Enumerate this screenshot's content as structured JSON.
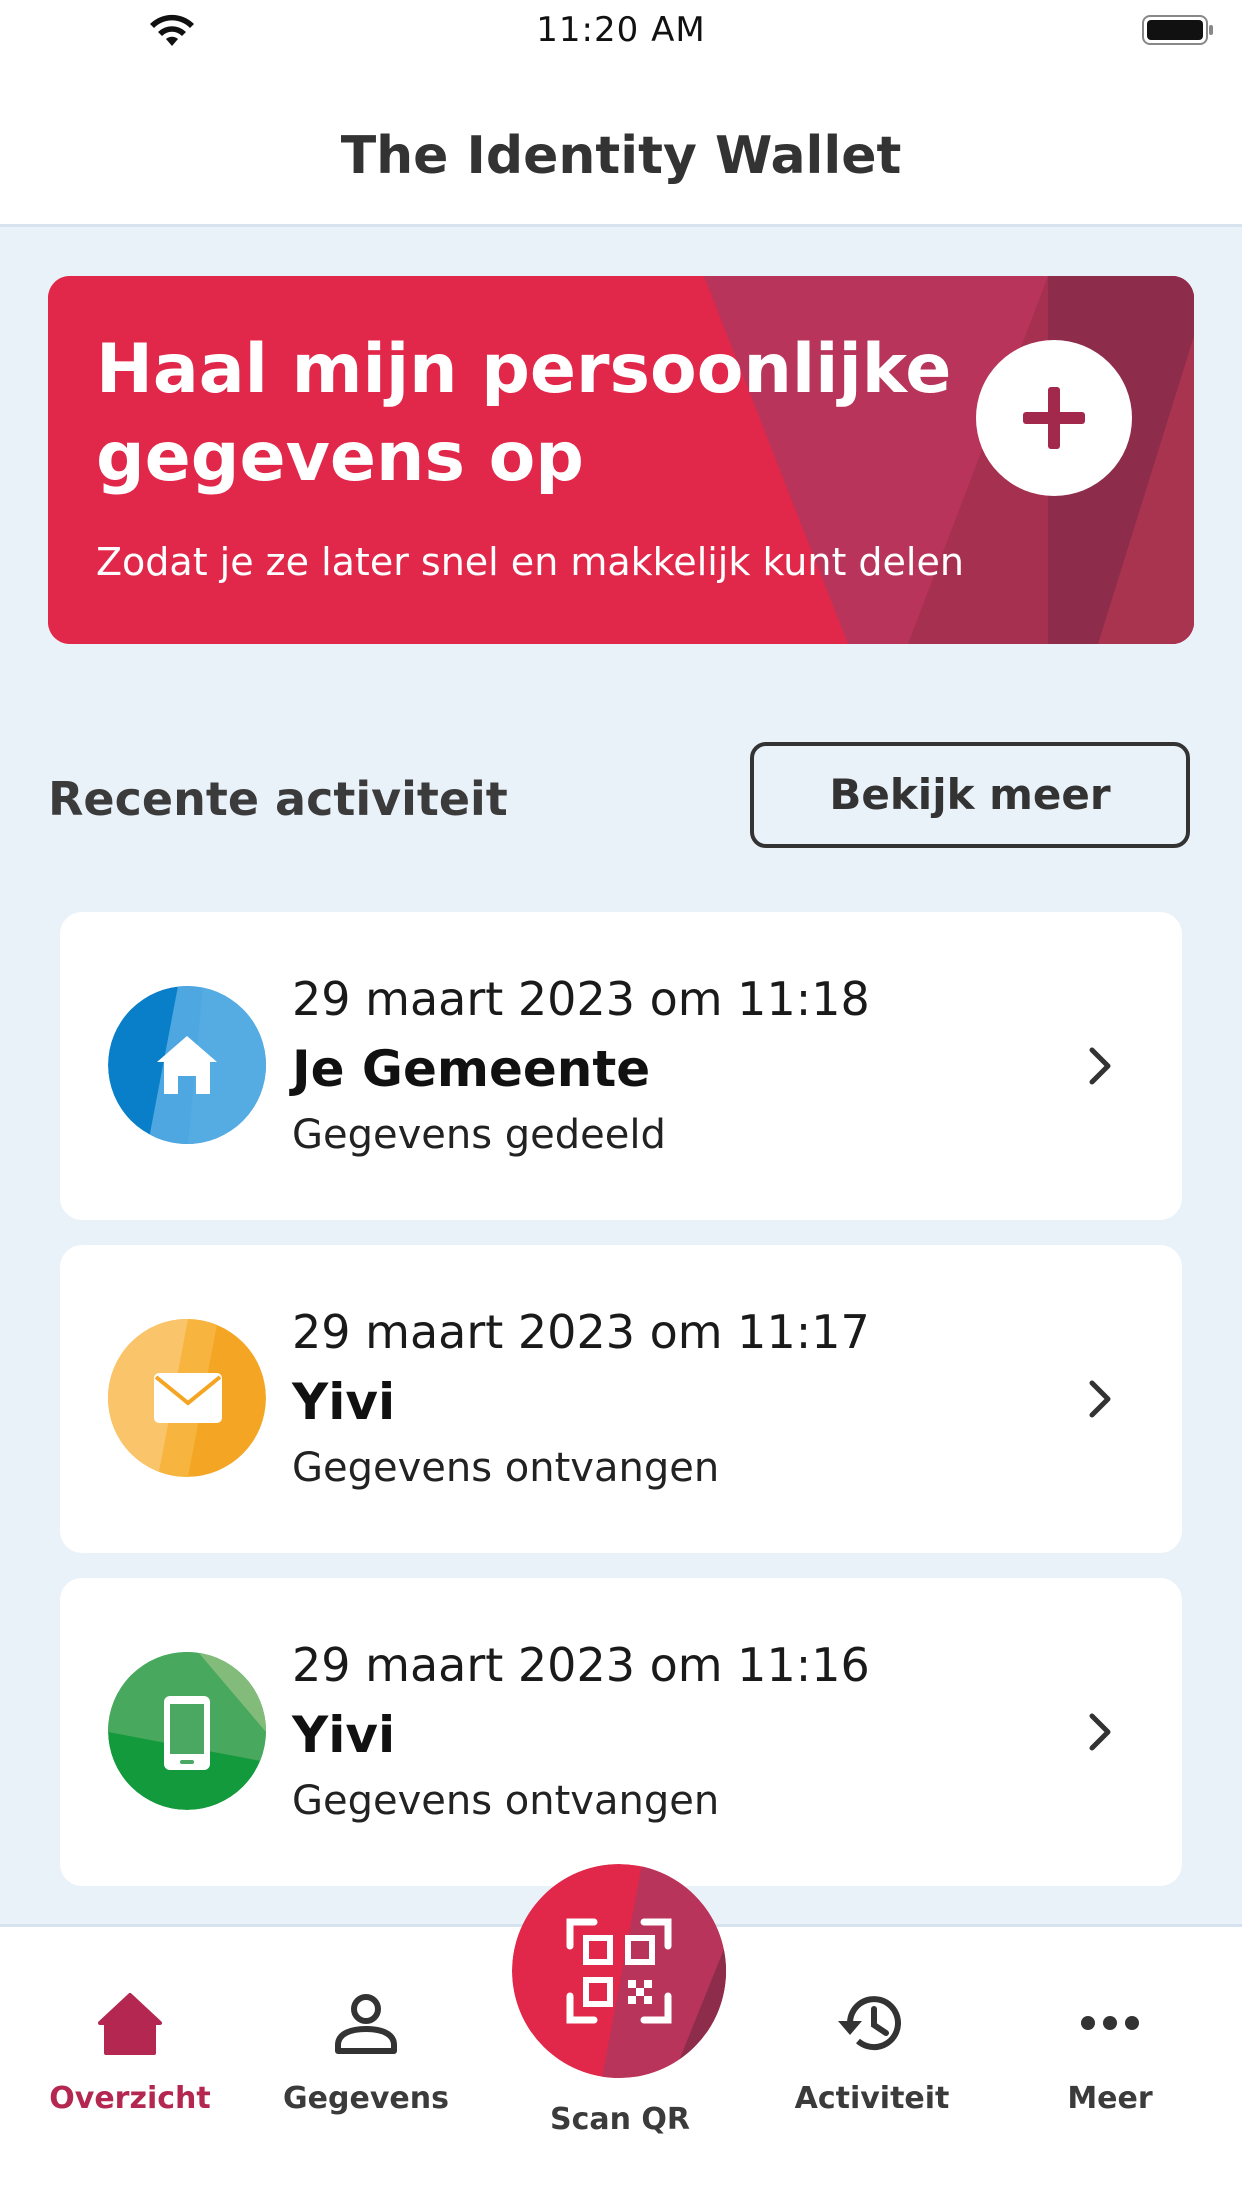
{
  "status": {
    "time": "11:20 AM"
  },
  "app": {
    "title": "The Identity Wallet"
  },
  "banner": {
    "title": "Haal mijn persoonlijke gegevens op",
    "subtitle": "Zodat je ze later snel en makkelijk kunt delen"
  },
  "activity": {
    "heading": "Recente activiteit",
    "more_label": "Bekijk meer",
    "items": [
      {
        "date": "29 maart 2023 om 11:18",
        "name": "Je Gemeente",
        "description": "Gegevens gedeeld",
        "icon": "home-icon"
      },
      {
        "date": "29 maart 2023 om 11:17",
        "name": "Yivi",
        "description": "Gegevens ontvangen",
        "icon": "envelope-icon"
      },
      {
        "date": "29 maart 2023 om 11:16",
        "name": "Yivi",
        "description": "Gegevens ontvangen",
        "icon": "phone-icon"
      }
    ]
  },
  "nav": {
    "overview": "Overzicht",
    "data": "Gegevens",
    "scan": "Scan QR",
    "activity": "Activiteit",
    "more": "Meer"
  },
  "colors": {
    "brand": "#e1284a",
    "accent": "#b32750",
    "text": "#333333"
  }
}
